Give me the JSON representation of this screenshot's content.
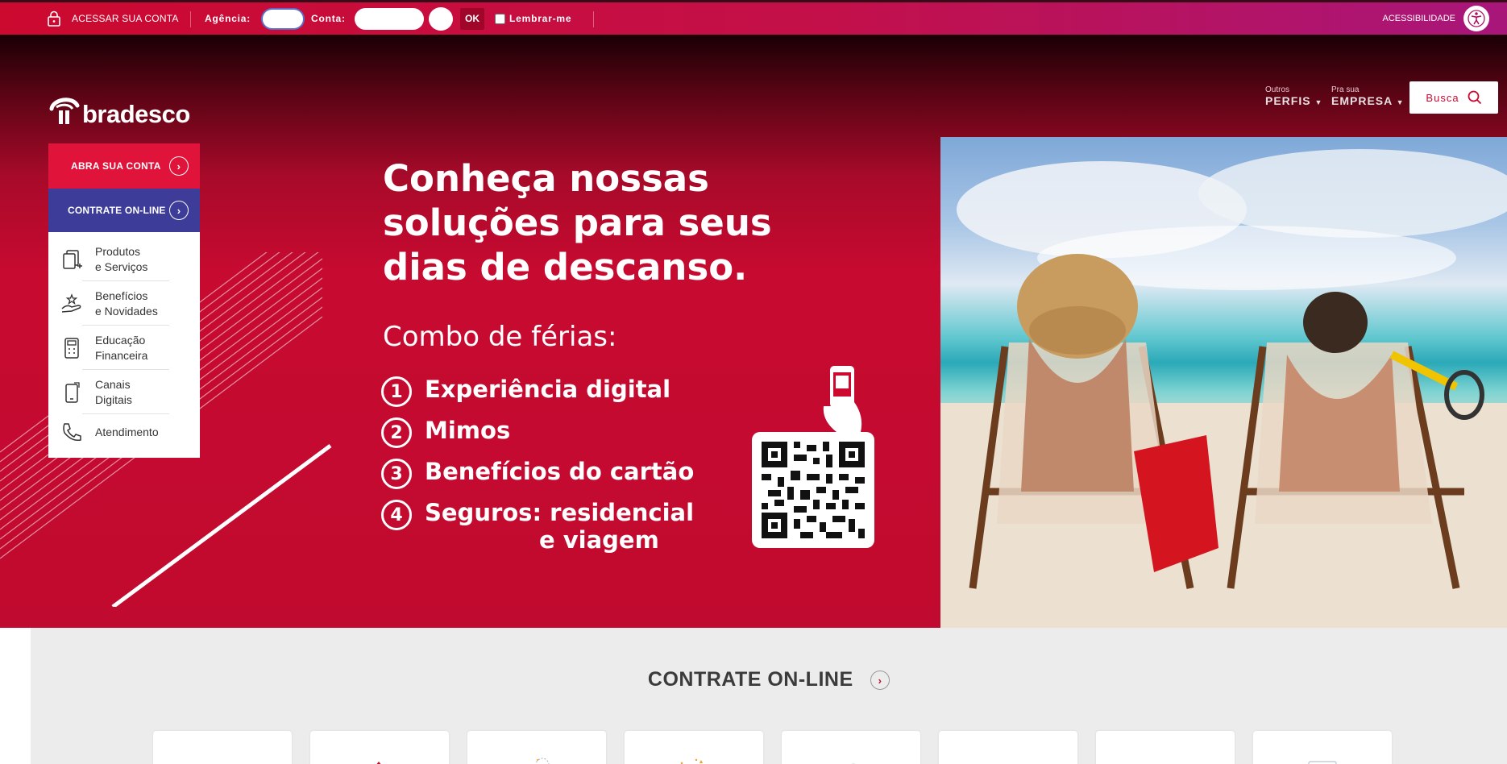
{
  "topbar": {
    "access_label": "ACESSAR SUA CONTA",
    "agencia_label": "Agência:",
    "agencia_value": "",
    "conta_label": "Conta:",
    "conta_value": "",
    "digito_value": "",
    "ok_label": "OK",
    "remember_label": "Lembrar-me",
    "accessibility_label": "ACESSIBILIDADE"
  },
  "header": {
    "logo_text": "bradesco",
    "profiles_small": "Outros",
    "profiles_big": "PERFIS",
    "empresa_small": "Pra sua",
    "empresa_big": "EMPRESA",
    "search_label": "Busca"
  },
  "side": {
    "cta_open": "ABRA SUA CONTA",
    "cta_hire": "CONTRATE ON-LINE",
    "items": [
      {
        "line1": "Produtos",
        "line2": "e Serviços"
      },
      {
        "line1": "Benefícios",
        "line2": "e Novidades"
      },
      {
        "line1": "Educação",
        "line2": "Financeira"
      },
      {
        "line1": "Canais",
        "line2": "Digitais"
      },
      {
        "line1": "Atendimento",
        "line2": ""
      }
    ]
  },
  "banner": {
    "headline": "Conheça nossas soluções para seus dias de descanso.",
    "combo": "Combo de férias:",
    "list": [
      {
        "num": "1",
        "text": "Experiência digital"
      },
      {
        "num": "2",
        "text": "Mimos"
      },
      {
        "num": "3",
        "text": "Benefícios do cartão"
      },
      {
        "num": "4",
        "text": "Seguros: residencial",
        "cont": "e viagem"
      }
    ]
  },
  "lower": {
    "title": "CONTRATE ON-LINE"
  },
  "colors": {
    "brand_red": "#cc092f",
    "brand_blue": "#3d3d99",
    "topbar_magenta": "#a8167a"
  }
}
